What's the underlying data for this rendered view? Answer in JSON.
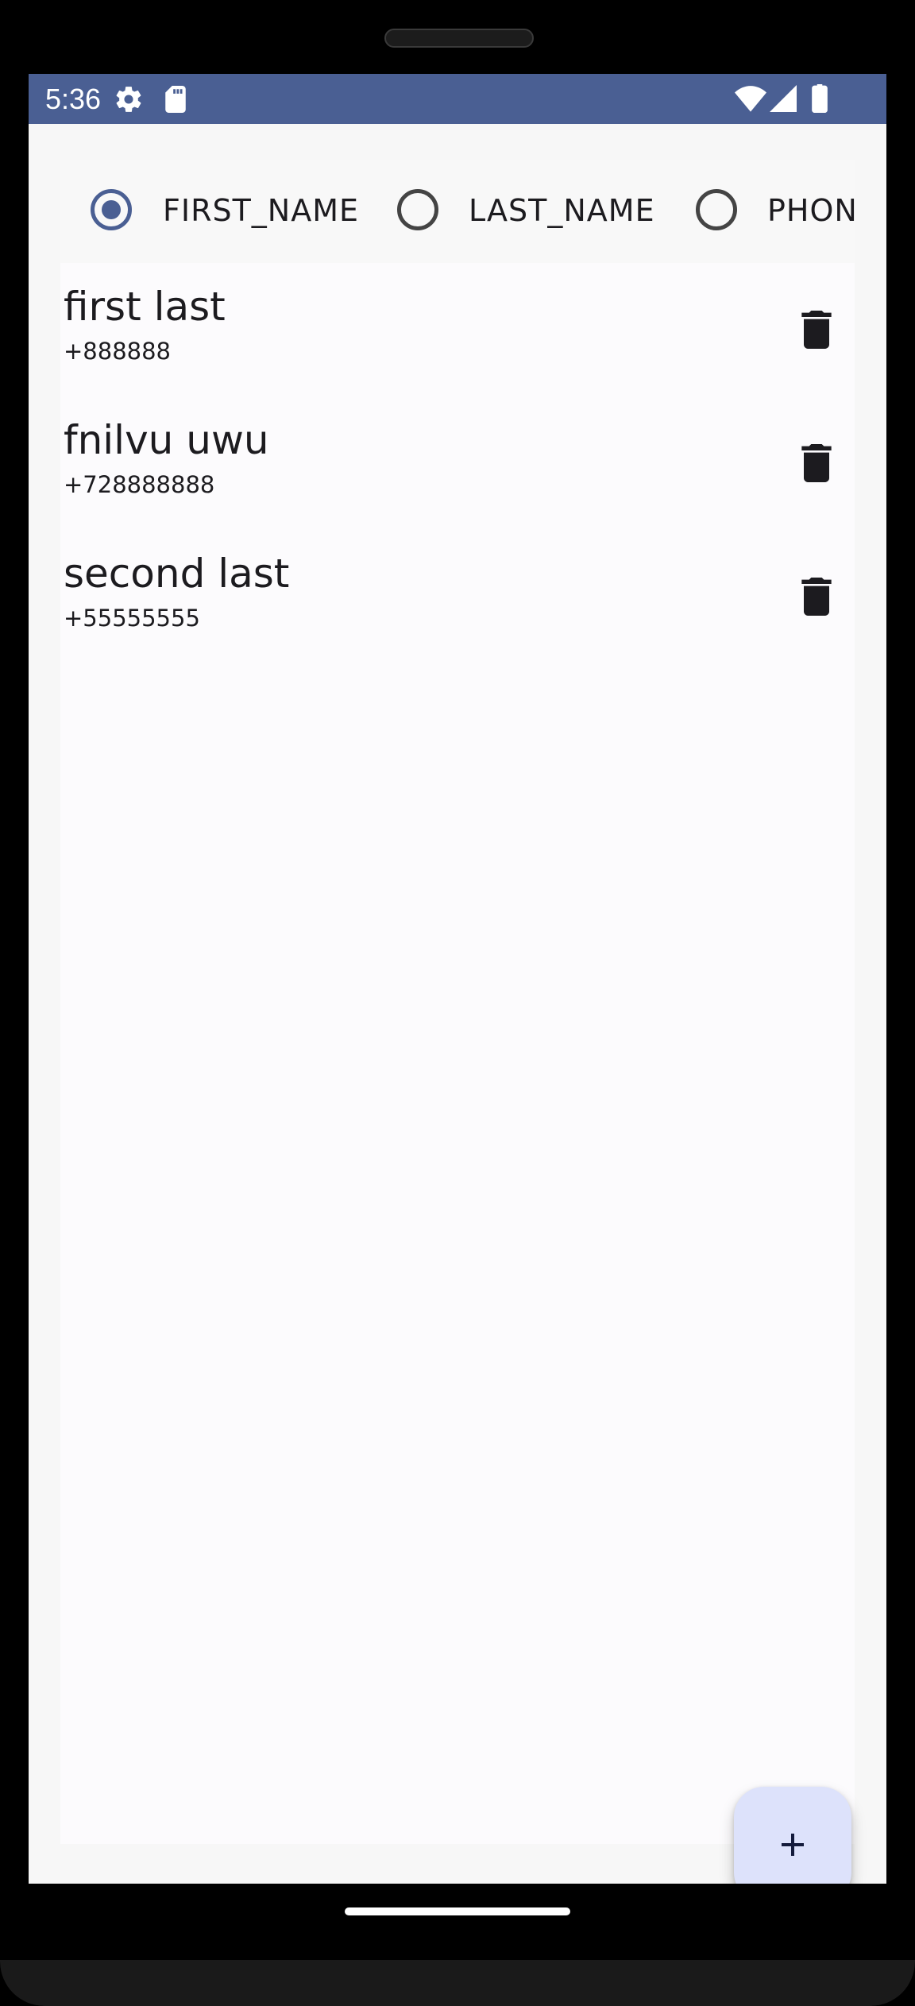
{
  "status_bar": {
    "time": "5:36",
    "left_icons": [
      "settings-icon",
      "sd-card-icon"
    ],
    "right_icons": [
      "wifi-icon",
      "cell-signal-icon",
      "battery-icon"
    ],
    "background": "#4a5f93"
  },
  "sort_options": [
    {
      "label": "FIRST_NAME",
      "selected": true
    },
    {
      "label": "LAST_NAME",
      "selected": false
    },
    {
      "label": "PHONE",
      "selected": false
    }
  ],
  "contacts": [
    {
      "name": "first last",
      "phone": "+888888"
    },
    {
      "name": "fnilvu uwu",
      "phone": "+728888888"
    },
    {
      "name": "second last",
      "phone": "+55555555"
    }
  ],
  "actions": {
    "delete_icon": "trash-icon",
    "fab_icon": "plus-icon"
  },
  "colors": {
    "accent": "#4a5f93",
    "fab_background": "#dde2fb",
    "text": "#1c1b1f"
  }
}
